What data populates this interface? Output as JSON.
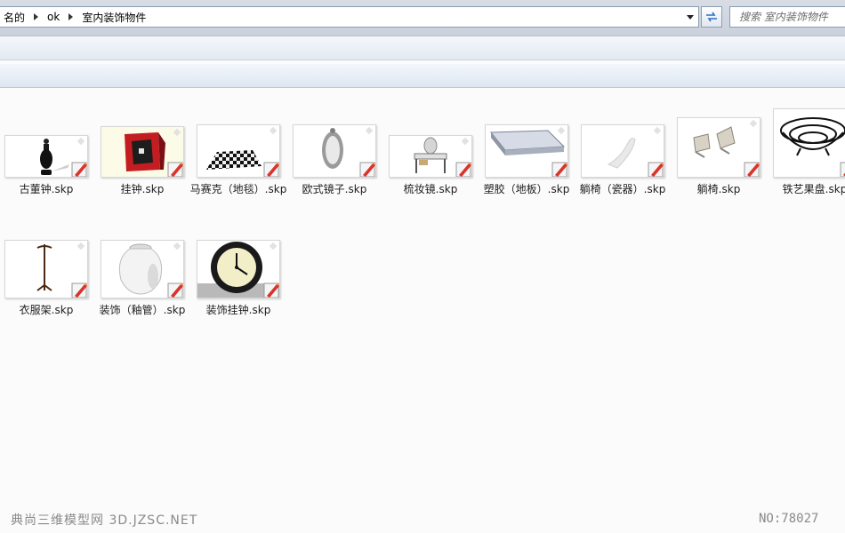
{
  "address_bar": {
    "crumbs": [
      "名的",
      "ok",
      "室内装饰物件"
    ]
  },
  "search": {
    "placeholder": "搜索 室内装饰物件"
  },
  "files": [
    {
      "label": "古董钟.skp",
      "icon": "antique-clock-thumbnail"
    },
    {
      "label": "挂钟.skp",
      "icon": "wall-clock-thumbnail"
    },
    {
      "label": "马赛克（地毯）.skp",
      "icon": "mosaic-carpet-thumbnail"
    },
    {
      "label": "欧式镜子.skp",
      "icon": "european-mirror-thumbnail"
    },
    {
      "label": "梳妆镜.skp",
      "icon": "dressing-mirror-thumbnail"
    },
    {
      "label": "塑胶（地板）.skp",
      "icon": "plastic-floor-thumbnail"
    },
    {
      "label": "躺椅（瓷器）.skp",
      "icon": "porcelain-lounger-thumbnail"
    },
    {
      "label": "躺椅.skp",
      "icon": "lounge-chair-thumbnail"
    },
    {
      "label": "铁艺果盘.skp",
      "icon": "iron-fruit-bowl-thumbnail"
    },
    {
      "label": "衣服架.skp",
      "icon": "coat-rack-thumbnail"
    },
    {
      "label": "装饰（釉管）.skp",
      "icon": "glazed-vase-thumbnail"
    },
    {
      "label": "装饰挂钟.skp",
      "icon": "decorative-wall-clock-thumbnail"
    }
  ],
  "watermark": {
    "left": "典尚三维模型网 3D.JZSC.NET",
    "right": "NO:78027"
  },
  "colors": {
    "badge_red": "#d9332b",
    "badge_orange": "#f0a35a"
  }
}
